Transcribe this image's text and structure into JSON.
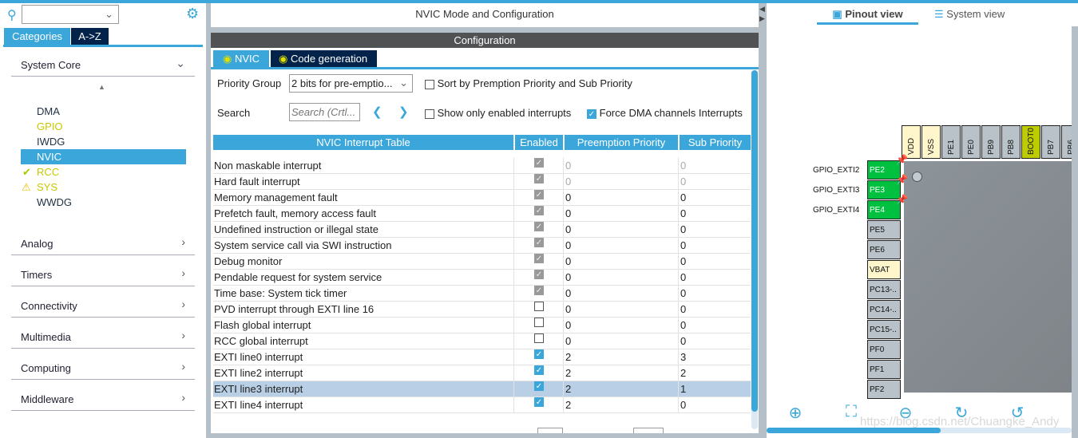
{
  "left": {
    "categories_tab": "Categories",
    "az_tab": "A->Z",
    "system_core": "System Core",
    "items": [
      {
        "label": "DMA",
        "color": "#223344",
        "status": ""
      },
      {
        "label": "GPIO",
        "color": "#c8c800",
        "status": ""
      },
      {
        "label": "IWDG",
        "color": "#223344",
        "status": ""
      },
      {
        "label": "NVIC",
        "color": "#ffffff",
        "status": "selected"
      },
      {
        "label": "RCC",
        "color": "#c8c800",
        "status": "check"
      },
      {
        "label": "SYS",
        "color": "#c8c800",
        "status": "warning"
      },
      {
        "label": "WWDG",
        "color": "#223344",
        "status": ""
      }
    ],
    "groups": [
      "Analog",
      "Timers",
      "Connectivity",
      "Multimedia",
      "Computing",
      "Middleware"
    ]
  },
  "center": {
    "title": "NVIC Mode and Configuration",
    "config_header": "Configuration",
    "tabs": [
      "NVIC",
      "Code generation"
    ],
    "priority_group_label": "Priority Group",
    "priority_group_value": "2 bits for pre-emptio...",
    "sort_label": "Sort by Premption Priority and Sub Priority",
    "sort_checked": false,
    "search_label": "Search",
    "search_placeholder": "Search (Crtl...",
    "show_enabled_label": "Show only enabled interrupts",
    "show_enabled_checked": false,
    "force_dma_label": "Force DMA channels Interrupts",
    "force_dma_checked": true,
    "columns": [
      "NVIC Interrupt Table",
      "Enabled",
      "Preemption Priority",
      "Sub Priority"
    ],
    "rows": [
      {
        "name": "Non maskable interrupt",
        "enabled": "locked",
        "pre": "0",
        "sub": "0",
        "dim": true
      },
      {
        "name": "Hard fault interrupt",
        "enabled": "locked",
        "pre": "0",
        "sub": "0",
        "dim": true
      },
      {
        "name": "Memory management fault",
        "enabled": "locked",
        "pre": "0",
        "sub": "0"
      },
      {
        "name": "Prefetch fault, memory access fault",
        "enabled": "locked",
        "pre": "0",
        "sub": "0"
      },
      {
        "name": "Undefined instruction or illegal state",
        "enabled": "locked",
        "pre": "0",
        "sub": "0"
      },
      {
        "name": "System service call via SWI instruction",
        "enabled": "locked",
        "pre": "0",
        "sub": "0"
      },
      {
        "name": "Debug monitor",
        "enabled": "locked",
        "pre": "0",
        "sub": "0"
      },
      {
        "name": "Pendable request for system service",
        "enabled": "locked",
        "pre": "0",
        "sub": "0"
      },
      {
        "name": "Time base: System tick timer",
        "enabled": "locked",
        "pre": "0",
        "sub": "0"
      },
      {
        "name": "PVD interrupt through EXTI line 16",
        "enabled": "off",
        "pre": "0",
        "sub": "0"
      },
      {
        "name": "Flash global interrupt",
        "enabled": "off",
        "pre": "0",
        "sub": "0"
      },
      {
        "name": "RCC global interrupt",
        "enabled": "off",
        "pre": "0",
        "sub": "0"
      },
      {
        "name": "EXTI line0 interrupt",
        "enabled": "on",
        "pre": "2",
        "sub": "3"
      },
      {
        "name": "EXTI line2 interrupt",
        "enabled": "on",
        "pre": "2",
        "sub": "2"
      },
      {
        "name": "EXTI line3 interrupt",
        "enabled": "on",
        "pre": "2",
        "sub": "1",
        "selected": true
      },
      {
        "name": "EXTI line4 interrupt",
        "enabled": "on",
        "pre": "2",
        "sub": "0"
      }
    ]
  },
  "right": {
    "pinout_tab": "Pinout view",
    "system_tab": "System view",
    "top_pins": [
      {
        "label": "VDD",
        "color": "#fff6cc"
      },
      {
        "label": "VSS",
        "color": "#fff6cc"
      },
      {
        "label": "PE1",
        "color": "#b8c2c8"
      },
      {
        "label": "PE0",
        "color": "#b8c2c8"
      },
      {
        "label": "PB9",
        "color": "#b8c2c8"
      },
      {
        "label": "PB8",
        "color": "#b8c2c8"
      },
      {
        "label": "BOOT0",
        "color": "#bccc00"
      },
      {
        "label": "PB7",
        "color": "#b8c2c8"
      },
      {
        "label": "PB6",
        "color": "#b8c2c8"
      }
    ],
    "side_pins": [
      {
        "label": "PE2",
        "color": "#00c040",
        "signal": "GPIO_EXTI2"
      },
      {
        "label": "PE3",
        "color": "#00c040",
        "signal": "GPIO_EXTI3"
      },
      {
        "label": "PE4",
        "color": "#00c040",
        "signal": "GPIO_EXTI4"
      },
      {
        "label": "PE5",
        "color": "#b8c2c8",
        "signal": ""
      },
      {
        "label": "PE6",
        "color": "#b8c2c8",
        "signal": ""
      },
      {
        "label": "VBAT",
        "color": "#fff6cc",
        "signal": ""
      },
      {
        "label": "PC13-..",
        "color": "#b8c2c8",
        "signal": ""
      },
      {
        "label": "PC14-..",
        "color": "#b8c2c8",
        "signal": ""
      },
      {
        "label": "PC15-..",
        "color": "#b8c2c8",
        "signal": ""
      },
      {
        "label": "PF0",
        "color": "#b8c2c8",
        "signal": ""
      },
      {
        "label": "PF1",
        "color": "#b8c2c8",
        "signal": ""
      },
      {
        "label": "PF2",
        "color": "#b8c2c8",
        "signal": ""
      }
    ],
    "watermark": "https://blog.csdn.net/Chuangke_Andy"
  }
}
